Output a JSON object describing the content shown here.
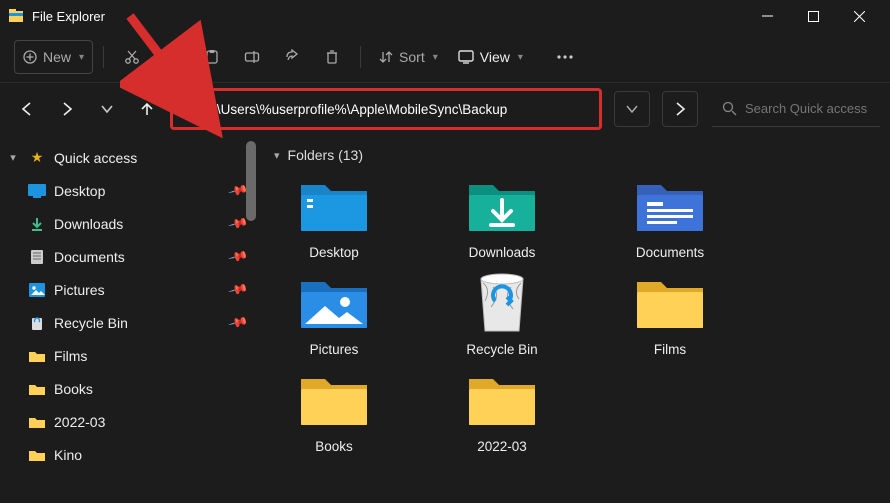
{
  "title": "File Explorer",
  "toolbar": {
    "new_label": "New",
    "sort_label": "Sort",
    "view_label": "View"
  },
  "address": {
    "path": "C:\\Users\\%userprofile%\\Apple\\MobileSync\\Backup"
  },
  "search": {
    "placeholder": "Search Quick access"
  },
  "sidebar": {
    "root_label": "Quick access",
    "items": [
      {
        "label": "Desktop",
        "pinned": true
      },
      {
        "label": "Downloads",
        "pinned": true
      },
      {
        "label": "Documents",
        "pinned": true
      },
      {
        "label": "Pictures",
        "pinned": true
      },
      {
        "label": "Recycle Bin",
        "pinned": true
      },
      {
        "label": "Films",
        "pinned": false
      },
      {
        "label": "Books",
        "pinned": false
      },
      {
        "label": "2022-03",
        "pinned": false
      },
      {
        "label": "Kino",
        "pinned": false
      }
    ]
  },
  "content": {
    "section_label": "Folders (13)",
    "folders": [
      {
        "label": "Desktop"
      },
      {
        "label": "Downloads"
      },
      {
        "label": "Documents"
      },
      {
        "label": "Pictures"
      },
      {
        "label": "Recycle Bin"
      },
      {
        "label": "Films"
      },
      {
        "label": "Books"
      },
      {
        "label": "2022-03"
      }
    ]
  }
}
